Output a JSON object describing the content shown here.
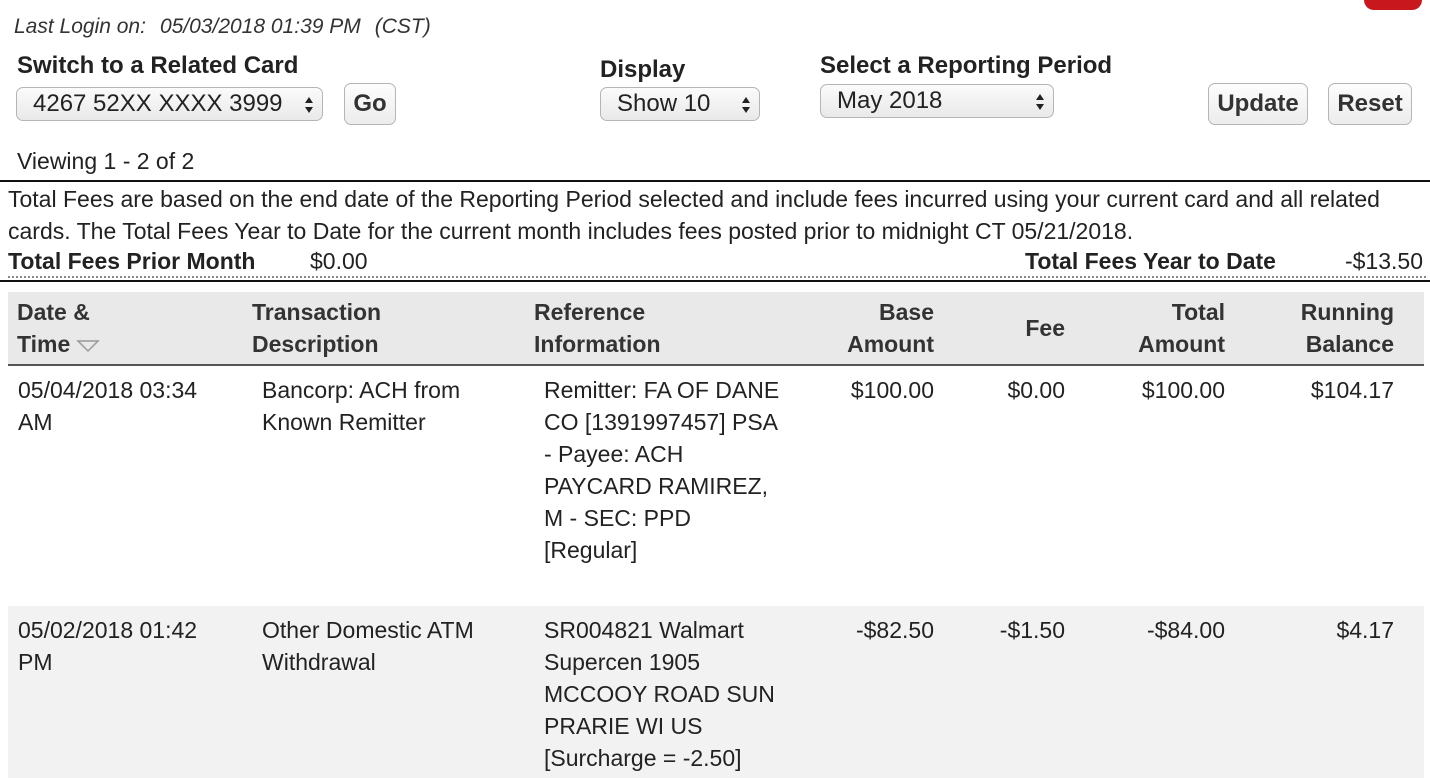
{
  "header": {
    "login_label": "Last Login on:",
    "login_value": "05/03/2018 01:39 PM",
    "timezone": "(CST)",
    "brand_color": "#c8181e"
  },
  "card_switch": {
    "label": "Switch to a Related Card",
    "selected": "4267 52XX XXXX 3999",
    "go_label": "Go"
  },
  "display": {
    "label": "Display",
    "selected": "Show 10"
  },
  "period": {
    "label": "Select a Reporting Period",
    "selected": "May 2018"
  },
  "actions": {
    "update_label": "Update",
    "reset_label": "Reset"
  },
  "viewing": "Viewing 1 - 2 of 2",
  "fees": {
    "description": "Total Fees are based on the end date of the Reporting Period selected and include fees incurred using your current card and all related cards. The Total Fees Year to Date for the current month includes fees posted prior to midnight CT 05/21/2018.",
    "prior_month_label": "Total Fees Prior Month",
    "prior_month_value": "$0.00",
    "ytd_label": "Total Fees Year to Date",
    "ytd_value": "-$13.50"
  },
  "table": {
    "headers": {
      "date_line1": "Date &",
      "date_line2": "Time",
      "desc_line1": "Transaction",
      "desc_line2": "Description",
      "ref_line1": "Reference",
      "ref_line2": "Information",
      "base_line1": "Base",
      "base_line2": "Amount",
      "fee": "Fee",
      "total_line1": "Total",
      "total_line2": "Amount",
      "balance_line1": "Running",
      "balance_line2": "Balance"
    },
    "rows": [
      {
        "date": "05/04/2018 03:34 AM",
        "description": "Bancorp: ACH from Known Remitter",
        "reference": "Remitter: FA OF DANE CO [1391997457] PSA - Payee: ACH PAYCARD RAMIREZ, M - SEC: PPD [Regular]",
        "base": "$100.00",
        "fee": "$0.00",
        "total": "$100.00",
        "balance": "$104.17"
      },
      {
        "date": "05/02/2018 01:42 PM",
        "description": "Other Domestic ATM Withdrawal",
        "reference": "SR004821 Walmart Supercen 1905 MCCOOY ROAD SUN PRARIE WI US [Surcharge = -2.50]",
        "base": "-$82.50",
        "fee": "-$1.50",
        "total": "-$84.00",
        "balance": "$4.17"
      }
    ]
  }
}
